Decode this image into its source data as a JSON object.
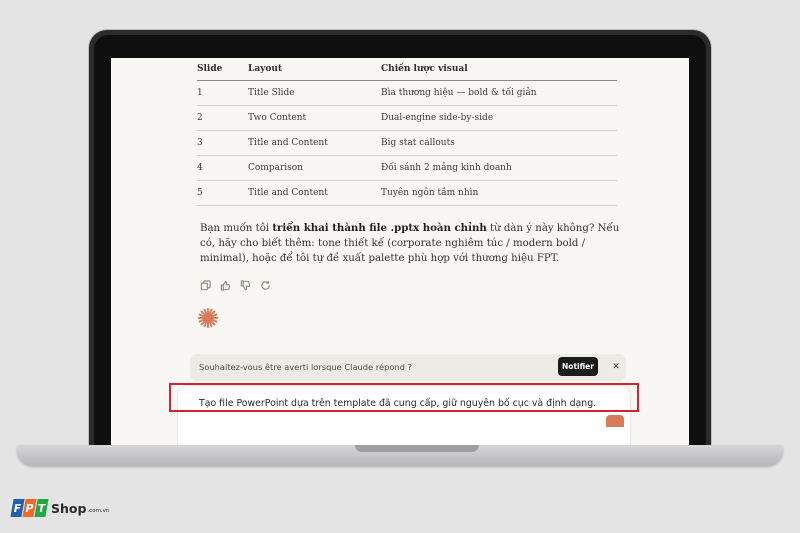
{
  "table": {
    "headers": [
      "Slide",
      "Layout",
      "Chiến lược visual"
    ],
    "rows": [
      [
        "1",
        "Title Slide",
        "Bìa thương hiệu — bold & tối giản"
      ],
      [
        "2",
        "Two Content",
        "Dual-engine side-by-side"
      ],
      [
        "3",
        "Title and Content",
        "Big stat callouts"
      ],
      [
        "4",
        "Comparison",
        "Đối sánh 2 mảng kinh doanh"
      ],
      [
        "5",
        "Title and Content",
        "Tuyên ngôn tầm nhìn"
      ]
    ]
  },
  "message": {
    "part1": "Bạn muốn tôi ",
    "bold": "triển khai thành file .pptx hoàn chỉnh",
    "part2": " từ dàn ý này không? Nếu có, hãy cho biết thêm: tone thiết kế (corporate nghiêm túc / modern bold / minimal), hoặc để tôi tự đề xuất palette phù hợp với thương hiệu FPT."
  },
  "actions": [
    "copy-icon",
    "thumbs-up-icon",
    "thumbs-down-icon",
    "retry-icon"
  ],
  "notification": {
    "text": "Souhaitez-vous être averti lorsque Claude répond ?",
    "button": "Notifier",
    "close": "✕"
  },
  "input": {
    "value": "Tạo file PowerPoint dựa trên template đã cung cấp, giữ nguyên bố cục và định dạng."
  },
  "colors": {
    "accent": "#d97a5b",
    "highlight": "#d42330",
    "brand_blue": "#1f60b4",
    "brand_orange": "#f2692b",
    "brand_green": "#22a845"
  },
  "brand": {
    "letters": [
      "F",
      "P",
      "T"
    ],
    "shop": "Shop",
    "domain": ".com.vn"
  }
}
